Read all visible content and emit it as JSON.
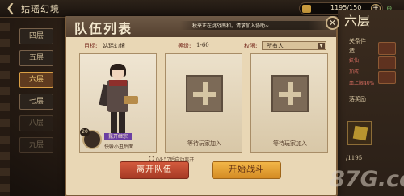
{
  "topbar": {
    "title": "姑瑶幻境",
    "currency_value": "1195/150",
    "plus_label": "+",
    "right_glyph": "⊕"
  },
  "floors": [
    {
      "label": "四层",
      "state": "normal"
    },
    {
      "label": "五层",
      "state": "normal"
    },
    {
      "label": "六层",
      "state": "active"
    },
    {
      "label": "七层",
      "state": "normal"
    },
    {
      "label": "八层",
      "state": "locked"
    },
    {
      "label": "九层",
      "state": "locked"
    }
  ],
  "right_panel": {
    "floor": "六层",
    "lines": [
      "关条件",
      "造"
    ],
    "red_lines": [
      "妖仙",
      "加成",
      "血上限40%"
    ],
    "reward_heading": "落奖励",
    "counter": "/1195"
  },
  "dialog": {
    "title": "队伍列表",
    "invite_text": "秋来正在挑战南和。请求加入协助~",
    "close_label": "✕",
    "filters": {
      "target_label": "目标:",
      "target_value": "姑瑶幻境",
      "level_label": "等级:",
      "level_value": "1-60",
      "perm_label": "权限:",
      "perm_value": "所有人"
    },
    "member": {
      "level": "20",
      "name_tag": "昆开继宗",
      "bottom_name": "快躲小丑后面"
    },
    "waiting_label": "等待玩家加入",
    "timer": "04:57后自动离开",
    "leave_button": "离开队伍",
    "start_button": "开始战斗"
  },
  "watermark": "87G.com",
  "colors": {
    "leave": "#c04a30",
    "start": "#e8a23a",
    "active_floor": "#d99f45"
  }
}
